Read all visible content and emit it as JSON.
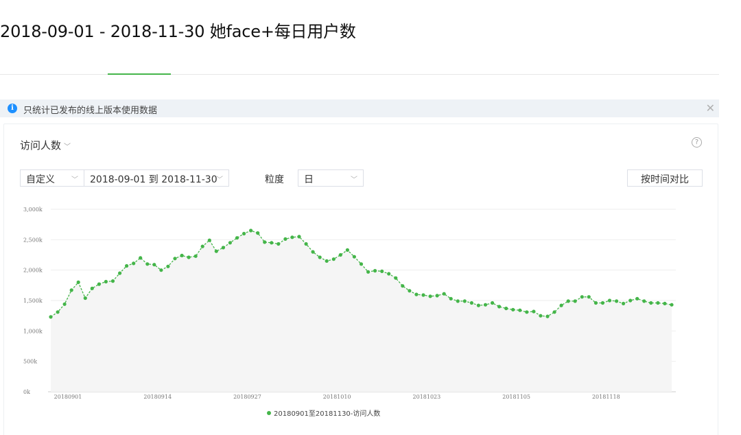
{
  "page_title": "2018-09-01 - 2018-11-30 她face+每日用户数",
  "notice": {
    "text": "只统计已发布的线上版本使用数据",
    "icon": "info-icon",
    "close_icon": "close-icon"
  },
  "controls": {
    "metric_label": "访问人数",
    "range_type": "自定义",
    "date_range": "2018-09-01 到 2018-11-30",
    "granularity_label": "粒度",
    "granularity_value": "日",
    "compare_button": "按时间对比",
    "help_icon": "question-icon"
  },
  "colors": {
    "accent": "#44b549",
    "area_fill": "#f5f5f5",
    "grid": "#eeeeee"
  },
  "chart_data": {
    "type": "line",
    "title": "",
    "xlabel": "",
    "ylabel": "",
    "ylim": [
      0,
      3000000
    ],
    "y_ticks": [
      "0k",
      "500k",
      "1,000k",
      "1,500k",
      "2,000k",
      "2,500k",
      "3,000k"
    ],
    "y_tick_values": [
      0,
      500000,
      1000000,
      1500000,
      2000000,
      2500000,
      3000000
    ],
    "x_tick_labels": [
      "20180901",
      "20180914",
      "20180927",
      "20181010",
      "20181023",
      "20181105",
      "20181118"
    ],
    "x_tick_indices": [
      0,
      13,
      26,
      39,
      52,
      65,
      78
    ],
    "grid": true,
    "legend_position": "bottom",
    "series": [
      {
        "name": "20180901至20181130-访问人数",
        "color": "#44b549",
        "values": [
          1230000,
          1310000,
          1440000,
          1670000,
          1800000,
          1540000,
          1700000,
          1770000,
          1810000,
          1820000,
          1950000,
          2070000,
          2110000,
          2200000,
          2100000,
          2090000,
          2000000,
          2060000,
          2190000,
          2240000,
          2210000,
          2230000,
          2390000,
          2490000,
          2310000,
          2370000,
          2450000,
          2530000,
          2600000,
          2650000,
          2610000,
          2460000,
          2450000,
          2430000,
          2510000,
          2540000,
          2550000,
          2430000,
          2300000,
          2210000,
          2150000,
          2180000,
          2250000,
          2330000,
          2220000,
          2100000,
          1970000,
          1990000,
          1980000,
          1940000,
          1870000,
          1740000,
          1660000,
          1600000,
          1590000,
          1570000,
          1580000,
          1610000,
          1530000,
          1490000,
          1490000,
          1460000,
          1420000,
          1430000,
          1460000,
          1400000,
          1370000,
          1350000,
          1340000,
          1310000,
          1320000,
          1250000,
          1240000,
          1310000,
          1420000,
          1490000,
          1490000,
          1560000,
          1560000,
          1460000,
          1460000,
          1500000,
          1490000,
          1450000,
          1500000,
          1530000,
          1490000,
          1460000,
          1460000,
          1450000,
          1430000
        ]
      }
    ]
  }
}
